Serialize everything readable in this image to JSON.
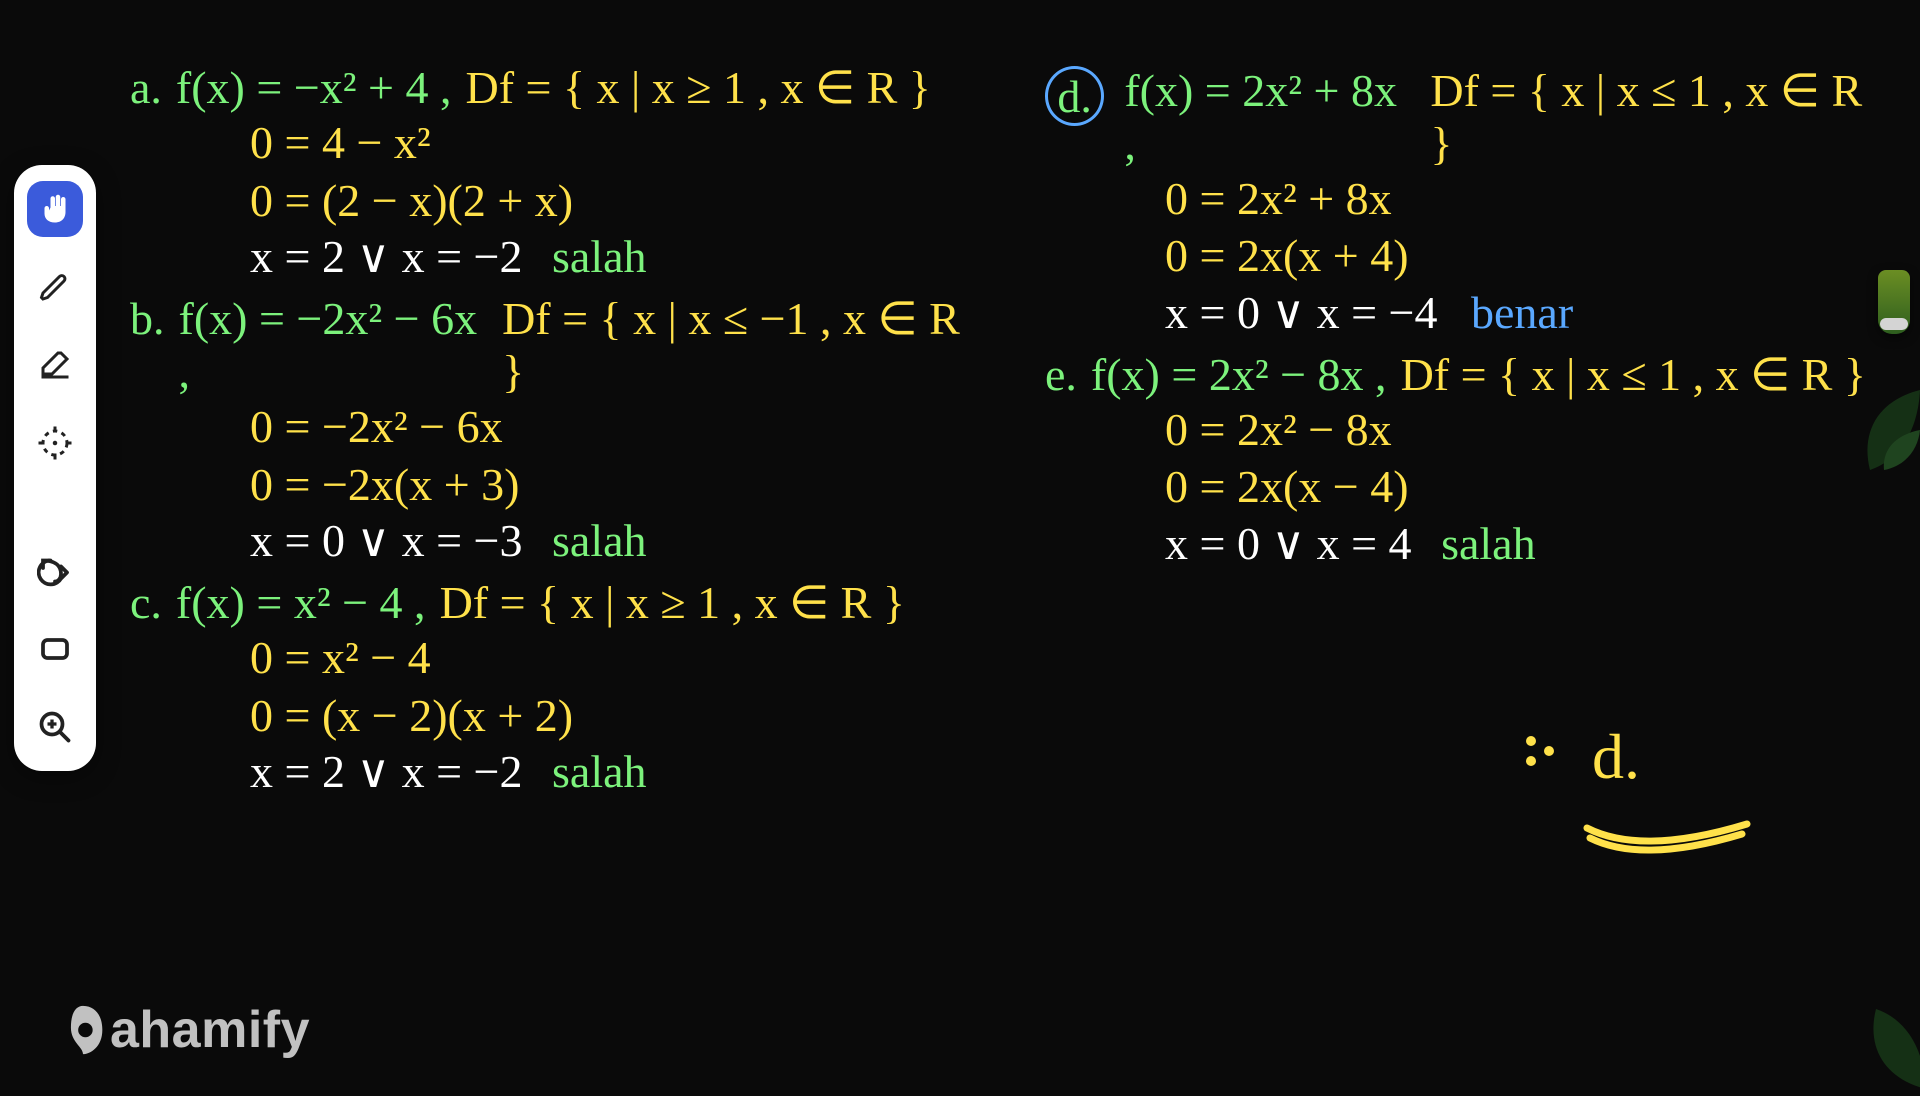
{
  "watermark": "ahamify",
  "answer_label": "d.",
  "problems": {
    "a": {
      "letter": "a.",
      "func": "f(x) = −x² + 4 ,",
      "domain": "Df = { x | x ≥ 1 , x ∈ R }",
      "steps": [
        "0 = 4 − x²",
        "0 = (2 − x)(2 + x)"
      ],
      "result_x": "x = 2  ∨  x = −2",
      "verdict": "salah",
      "verdict_style": "green"
    },
    "b": {
      "letter": "b.",
      "func": "f(x) = −2x² − 6x ,",
      "domain": "Df = { x | x ≤ −1 , x ∈ R }",
      "steps": [
        "0 = −2x² − 6x",
        "0 = −2x(x + 3)"
      ],
      "result_x": "x = 0  ∨  x = −3",
      "verdict": "salah",
      "verdict_style": "green"
    },
    "c": {
      "letter": "c.",
      "func": "f(x) = x² − 4 ,",
      "domain": "Df = { x | x ≥ 1 , x ∈ R }",
      "steps": [
        "0 = x² − 4",
        "0 = (x − 2)(x + 2)"
      ],
      "result_x": "x = 2  ∨  x = −2",
      "verdict": "salah",
      "verdict_style": "green"
    },
    "d": {
      "letter": "d.",
      "func": "f(x) = 2x² + 8x ,",
      "domain": "Df = { x | x ≤ 1 , x ∈ R }",
      "steps": [
        "0 = 2x² + 8x",
        "0 = 2x(x + 4)"
      ],
      "result_x": "x = 0  ∨  x = −4",
      "verdict": "benar",
      "verdict_style": "blue"
    },
    "e": {
      "letter": "e.",
      "func": "f(x) = 2x² − 8x ,",
      "domain": "Df = { x | x ≤ 1 , x ∈ R }",
      "steps": [
        "0 = 2x² − 8x",
        "0 = 2x(x − 4)"
      ],
      "result_x": "x = 0  ∨  x = 4",
      "verdict": "salah",
      "verdict_style": "green"
    }
  },
  "tools": {
    "pointer": "pointer-tool",
    "pen": "pen-tool",
    "eraser": "eraser-tool",
    "target": "shape-tool",
    "undo": "undo-tool",
    "rect": "rectangle-tool",
    "zoom": "zoom-tool"
  }
}
